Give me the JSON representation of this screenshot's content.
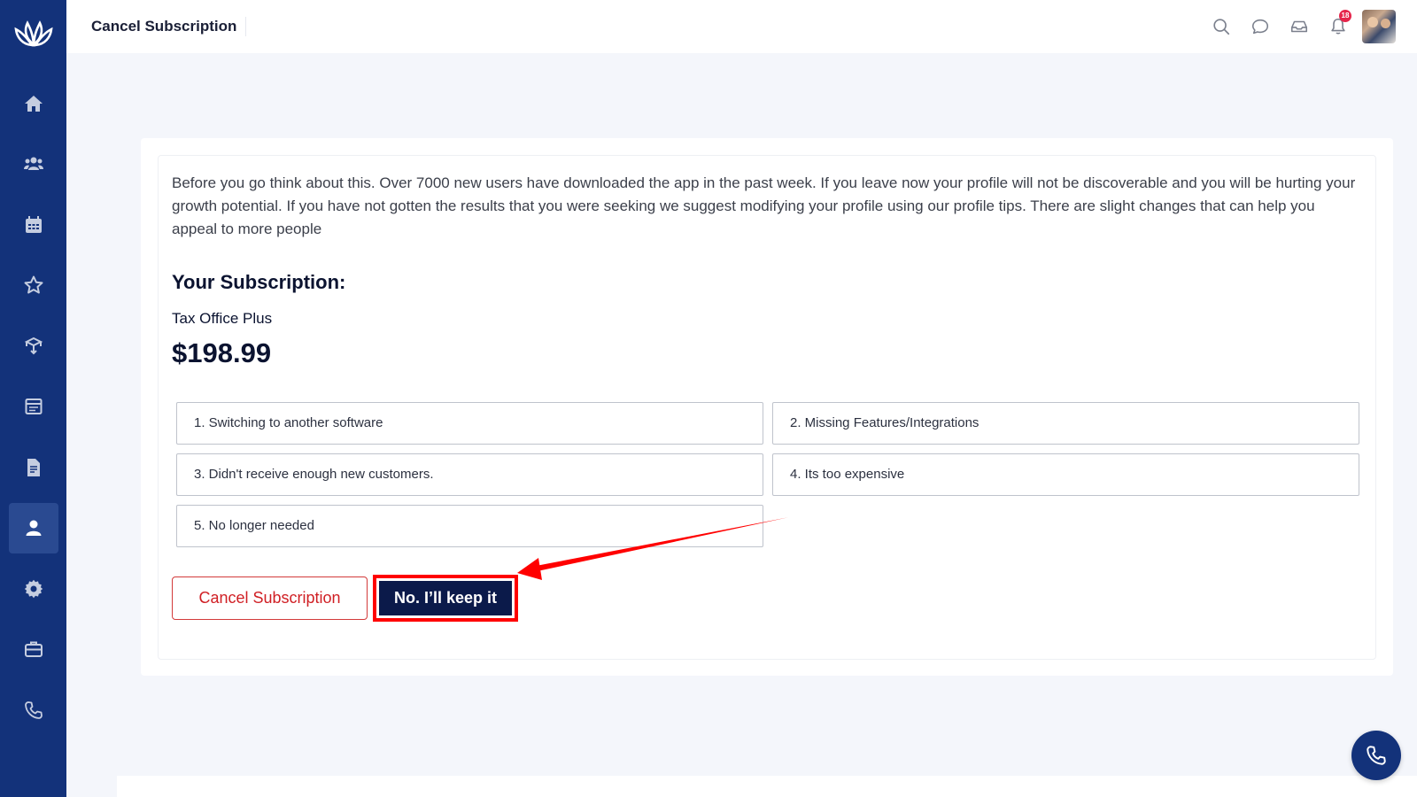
{
  "header": {
    "title": "Cancel Subscription",
    "notification_count": "18"
  },
  "sidebar": {
    "items": [
      {
        "icon": "home-icon"
      },
      {
        "icon": "users-icon"
      },
      {
        "icon": "calendar-icon"
      },
      {
        "icon": "star-icon"
      },
      {
        "icon": "box-icon"
      },
      {
        "icon": "schedule-icon"
      },
      {
        "icon": "document-icon"
      },
      {
        "icon": "user-icon",
        "active": true
      },
      {
        "icon": "settings-icon"
      },
      {
        "icon": "briefcase-icon"
      },
      {
        "icon": "phone-icon"
      }
    ]
  },
  "content": {
    "intro": "Before you go think about this. Over 7000 new users have downloaded the app in the past week. If you leave now your profile will not be discoverable and you will be hurting your growth potential. If you have not gotten the results that you were seeking we suggest modifying your profile using our profile tips. There are slight changes that can help you appeal to more people",
    "subscription_heading": "Your Subscription:",
    "plan_name": "Tax Office Plus",
    "plan_price": "$198.99",
    "reasons": [
      "1. Switching to another software",
      "2. Missing Features/Integrations",
      "3. Didn't receive enough new customers.",
      "4. Its too expensive",
      "5. No longer needed"
    ],
    "cancel_button": "Cancel Subscription",
    "keep_button": "No. I’ll keep it"
  },
  "colors": {
    "sidebar": "#13327a",
    "primary_dark": "#0b1a4a",
    "danger": "#d01f24",
    "annotation": "#ff0000"
  }
}
